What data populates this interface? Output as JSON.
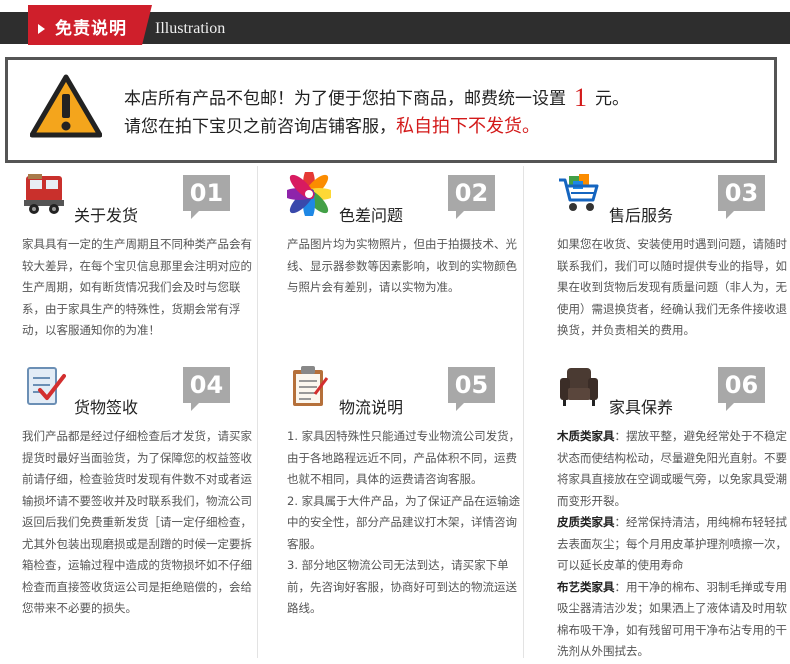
{
  "header": {
    "title": "免责说明",
    "subtitle": "Illustration"
  },
  "notice": {
    "line1_prefix": "本店所有产品不包邮！为了便于您拍下商品，邮费统一设置",
    "price": "1",
    "line1_suffix": "元。",
    "line2_prefix": "请您在拍下宝贝之前咨询店铺客服，",
    "line2_red": "私自拍下不发货。"
  },
  "cards": [
    {
      "num": "01",
      "title": "关于发货",
      "icon": "truck-icon",
      "text": "家具具有一定的生产周期且不同种类产品会有较大差异，在每个宝贝信息那里会注明对应的生产周期，如有断货情况我们会及时与您联系，由于家具生产的特殊性，货期会常有浮动，以客服通知你的为准！"
    },
    {
      "num": "02",
      "title": "色差问题",
      "icon": "color-wheel-icon",
      "text": "产品图片均为实物照片，但由于拍摄技术、光线、显示器参数等因素影响，收到的实物颜色与照片会有差别，请以实物为准。"
    },
    {
      "num": "03",
      "title": "售后服务",
      "icon": "shopping-cart-icon",
      "text": "如果您在收货、安装使用时遇到问题，请随时联系我们，我们可以随时提供专业的指导，如果在收到货物后发现有质量问题（非人为，无使用）需退换货者，经确认我们无条件接收退换货，并负责相关的费用。"
    },
    {
      "num": "04",
      "title": "货物签收",
      "icon": "checklist-icon",
      "text": "我们产品都是经过仔细检查后才发货，请买家提货时最好当面验货，为了保障您的权益签收前请仔细，检查验货时发现有件数不对或者运输损坏请不要签收并及时联系我们，物流公司返回后我们免费重新发货［请一定仔细检查，尤其外包装出现磨损或是刮蹭的时候一定要拆箱检查，运输过程中造成的货物损坏如不仔细检查而直接签收货运公司是拒绝赔偿的，会给您带来不必要的损失。"
    },
    {
      "num": "05",
      "title": "物流说明",
      "icon": "clipboard-icon",
      "paras": [
        "1. 家具因特殊性只能通过专业物流公司发货，由于各地路程远近不同，产品体积不同，运费也就不相同，具体的运费请咨询客服。",
        "2. 家具属于大件产品，为了保证产品在运输途中的安全性，部分产品建议打木架，详情咨询客服。",
        "3. 部分地区物流公司无法到达，请买家下单前，先咨询好客服，协商好可到达的物流运送路线。"
      ]
    },
    {
      "num": "06",
      "title": "家具保养",
      "icon": "armchair-icon",
      "care": [
        {
          "label": "木质类家具",
          "text": "：摆放平整，避免经常处于不稳定状态而使结构松动，尽量避免阳光直射。不要将家具直接放在空调或暖气旁，以免家具受潮而变形开裂。"
        },
        {
          "label": "皮质类家具",
          "text": "：经常保持清洁，用纯棉布轻轻拭去表面灰尘；每个月用皮革护理剂喷擦一次，可以延长皮革的使用寿命"
        },
        {
          "label": "布艺类家具",
          "text": "：用干净的棉布、羽制毛掸或专用吸尘器清洁沙发；如果洒上了液体请及时用软棉布吸干净，如有残留可用干净布沾专用的干洗剂从外围拭去。"
        }
      ]
    }
  ]
}
